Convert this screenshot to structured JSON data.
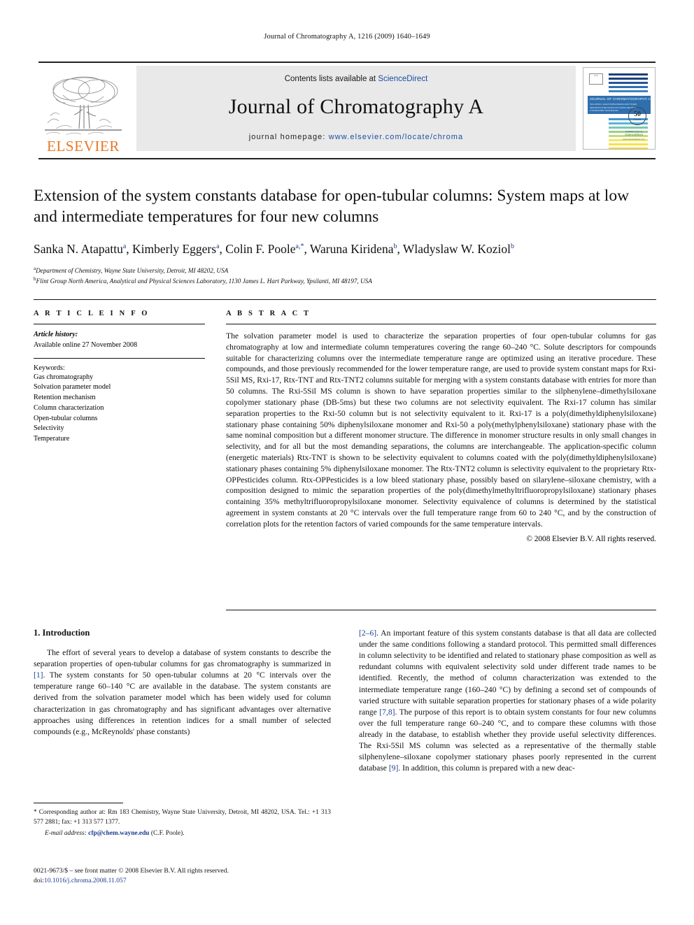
{
  "running_head": "Journal of Chromatography A, 1216 (2009) 1640–1649",
  "masthead": {
    "publisher_name": "ELSEVIER",
    "contents_prefix": "Contents lists available at ",
    "contents_link": "ScienceDirect",
    "journal_title": "Journal of Chromatography A",
    "homepage_label": "journal homepage:",
    "homepage_url": "www.elsevier.com/locate/chroma",
    "cover": {
      "journal_name": "JOURNAL OF CHROMATOGRAPHY A",
      "subtitle": "INCLUDING / ELECTROPHORESIS AND OTHER SEPARATION METHODS INCLUDING RELATED HYPHENATED TECHNIQUES",
      "anniversary_number": "50",
      "anniversary_label": "YEARS",
      "foot_top": "Available online at",
      "foot_brand": "ScienceDirect",
      "foot_url": "www.sciencedirect.com"
    }
  },
  "article": {
    "title": "Extension of the system constants database for open-tubular columns: System maps at low and intermediate temperatures for four new columns",
    "authors": [
      {
        "name": "Sanka N. Atapattu",
        "marks": "a"
      },
      {
        "name": "Kimberly Eggers",
        "marks": "a"
      },
      {
        "name": "Colin F. Poole",
        "marks": "a,*"
      },
      {
        "name": "Waruna Kiridena",
        "marks": "b"
      },
      {
        "name": "Wladyslaw W. Koziol",
        "marks": "b"
      }
    ],
    "affiliations": [
      {
        "mark": "a",
        "text": "Department of Chemistry, Wayne State University, Detroit, MI 48202, USA"
      },
      {
        "mark": "b",
        "text": "Flint Group North America, Analytical and Physical Sciences Laboratory, 1130 James L. Hart Parkway, Ypsilanti, MI 48197, USA"
      }
    ]
  },
  "article_info": {
    "heading": "A R T I C L E   I N F O",
    "history_label": "Article history:",
    "history_value": "Available online 27 November 2008",
    "keywords_label": "Keywords:",
    "keywords": [
      "Gas chromatography",
      "Solvation parameter model",
      "Retention mechanism",
      "Column characterization",
      "Open-tubular columns",
      "Selectivity",
      "Temperature"
    ]
  },
  "abstract": {
    "heading": "A B S T R A C T",
    "text": "The solvation parameter model is used to characterize the separation properties of four open-tubular columns for gas chromatography at low and intermediate column temperatures covering the range 60–240 °C. Solute descriptors for compounds suitable for characterizing columns over the intermediate temperature range are optimized using an iterative procedure. These compounds, and those previously recommended for the lower temperature range, are used to provide system constant maps for Rxi-5Sil MS, Rxi-17, Rtx-TNT and Rtx-TNT2 columns suitable for merging with a system constants database with entries for more than 50 columns. The Rxi-5Sil MS column is shown to have separation properties similar to the silphenylene–dimethylsiloxane copolymer stationary phase (DB-5ms) but these two columns are not selectivity equivalent. The Rxi-17 column has similar separation properties to the Rxi-50 column but is not selectivity equivalent to it. Rxi-17 is a poly(dimethyldiphenylsiloxane) stationary phase containing 50% diphenylsiloxane monomer and Rxi-50 a poly(methylphenylsiloxane) stationary phase with the same nominal composition but a different monomer structure. The difference in monomer structure results in only small changes in selectivity, and for all but the most demanding separations, the columns are interchangeable. The application-specific column (energetic materials) Rtx-TNT is shown to be selectivity equivalent to columns coated with the poly(dimethyldiphenylsiloxane) stationary phases containing 5% diphenylsiloxane monomer. The Rtx-TNT2 column is selectivity equivalent to the proprietary Rtx-OPPesticides column. Rtx-OPPesticides is a low bleed stationary phase, possibly based on silarylene–siloxane chemistry, with a composition designed to mimic the separation properties of the poly(dimethylmethyltrifluoropropylsiloxane) stationary phases containing 35% methyltrifluoropropylsiloxane monomer. Selectivity equivalence of columns is determined by the statistical agreement in system constants at 20 °C intervals over the full temperature range from 60 to 240 °C, and by the construction of correlation plots for the retention factors of varied compounds for the same temperature intervals.",
    "copyright": "© 2008 Elsevier B.V. All rights reserved."
  },
  "body": {
    "section_heading": "1. Introduction",
    "left_paragraph_part1": "The effort of several years to develop a database of system constants to describe the separation properties of open-tubular columns for gas chromatography is summarized in ",
    "left_ref1": "[1]",
    "left_paragraph_part2": ". The system constants for 50 open-tubular columns at 20 °C intervals over the temperature range 60–140 °C are available in the database. The system constants are derived from the solvation parameter model which has been widely used for column characterization in gas chromatography and has significant advantages over alternative approaches using differences in retention indices for a small number of selected compounds (e.g., McReynolds' phase constants)",
    "right_ref1": "[2–6]",
    "right_paragraph_part1": ". An important feature of this system constants database is that all data are collected under the same conditions following a standard protocol. This permitted small differences in column selectivity to be identified and related to stationary phase composition as well as redundant columns with equivalent selectivity sold under different trade names to be identified. Recently, the method of column characterization was extended to the intermediate temperature range (160–240 °C) by defining a second set of compounds of varied structure with suitable separation properties for stationary phases of a wide polarity range ",
    "right_ref2": "[7,8]",
    "right_paragraph_part2": ". The purpose of this report is to obtain system constants for four new columns over the full temperature range 60–240 °C, and to compare these columns with those already in the database, to establish whether they provide useful selectivity differences. The Rxi-5Sil MS column was selected as a representative of the thermally stable silphenylene–siloxane copolymer stationary phases poorly represented in the current database ",
    "right_ref3": "[9]",
    "right_paragraph_part3": ". In addition, this column is prepared with a new deac-"
  },
  "footnotes": {
    "corresponding": "* Corresponding author at: Rm 183 Chemistry, Wayne State University, Detroit, MI 48202, USA. Tel.: +1 313 577 2881; fax: +1 313 577 1377.",
    "email_label": "E-mail address:",
    "email": "cfp@chem.wayne.edu",
    "email_owner": "(C.F. Poole).",
    "issn_line": "0021-9673/$ – see front matter © 2008 Elsevier B.V. All rights reserved.",
    "doi_label": "doi:",
    "doi_value": "10.1016/j.chroma.2008.11.057"
  },
  "colors": {
    "elsevier_orange": "#E87722",
    "link_blue": "#1a4fa0",
    "ref_blue": "#1a3f8f",
    "banner_grey": "#e9e9e9",
    "cover_band_blue": "#2f6fae"
  }
}
